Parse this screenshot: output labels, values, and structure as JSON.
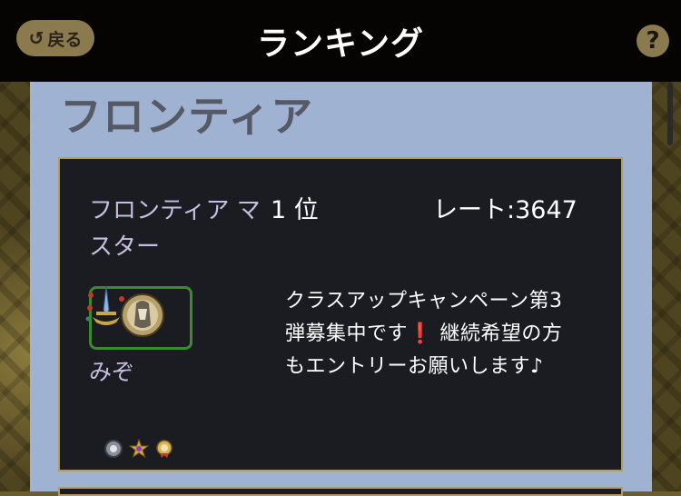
{
  "header": {
    "back_label": "戻る",
    "back_icon": "undo-arrow-icon",
    "title": "ランキング",
    "help_label": "?",
    "help_icon": "question-circle-icon"
  },
  "section": {
    "title": "フロンティア"
  },
  "entry": {
    "league": "フロンティア マスター",
    "rank": "1 位",
    "rate": "レート:3647",
    "player_name": "みぞ",
    "comment": "クラスアップキャンペーン第3弾募集中です❗ 継続希望の方もエントリーお願いします♪",
    "badges": [
      "silver-orb-badge-icon",
      "gold-star-badge-icon",
      "gold-medal-badge-icon"
    ]
  },
  "colors": {
    "header_bg": "#050403",
    "panel_bg": "#9fb2d2",
    "card_bg": "#1a1c22",
    "card_border": "#b59c5a",
    "avatar_border": "#3d8a2e",
    "button_bg": "#8b7a4e"
  }
}
